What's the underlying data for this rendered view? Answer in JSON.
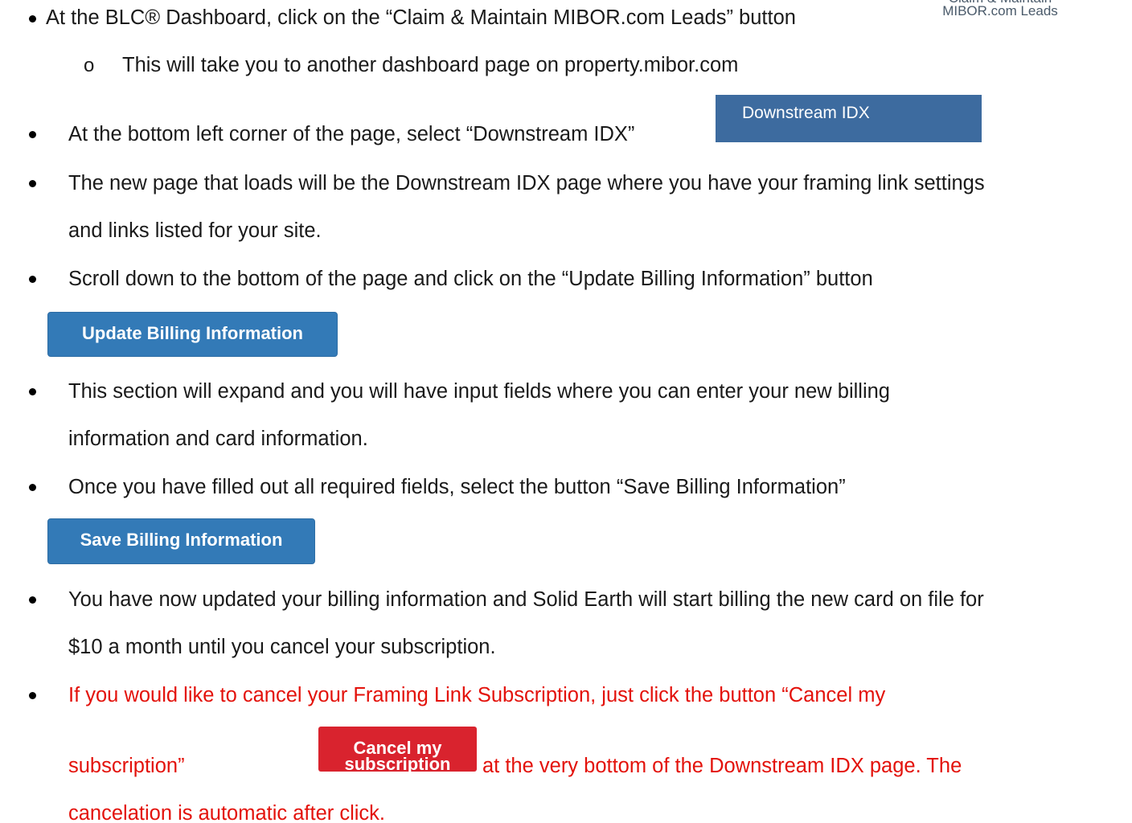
{
  "steps": [
    {
      "text": "At the BLC® Dashboard, click on the “Claim & Maintain MIBOR.com Leads” button"
    },
    {
      "text": "This will take you to another dashboard page on property.mibor.com",
      "sub_marker": "o"
    },
    {
      "text": "At the bottom left corner of the page, select “Downstream IDX”"
    },
    {
      "text_line1": "The new page that loads will be the Downstream IDX page where you have your framing link settings",
      "text_line2": "and links listed for your site."
    },
    {
      "text": "Scroll down to the bottom of the page and click on the “Update Billing Information” button"
    },
    {
      "text_line1": "This section will expand and you will have input fields where you can enter your new billing",
      "text_line2": "information and card information."
    },
    {
      "text": "Once you have filled out all required fields, select the button “Save Billing Information”"
    },
    {
      "text_line1": "You have now updated your billing information and Solid Earth will start billing the new card on file for",
      "text_line2": "$10 a month until you cancel your subscription."
    },
    {
      "text_line1": "If you would like to cancel your Framing Link Subscription, just click the button “Cancel my",
      "text_line2a": "subscription”",
      "text_line2b": "at the very bottom of the Downstream IDX page. The",
      "text_line3": "cancelation is automatic after click."
    }
  ],
  "buttons": {
    "claim_line1": "Claim & Maintain",
    "claim_line2": "MIBOR.com Leads",
    "downstream": "Downstream IDX",
    "update_billing": "Update Billing Information",
    "save_billing": "Save Billing Information",
    "cancel_subscription": "Cancel my subscription"
  },
  "colors": {
    "warning_text": "#e3120b",
    "downstream_button": "#3d6b9f",
    "billing_buttons": "#337ab7",
    "cancel_button": "#d9232e"
  }
}
